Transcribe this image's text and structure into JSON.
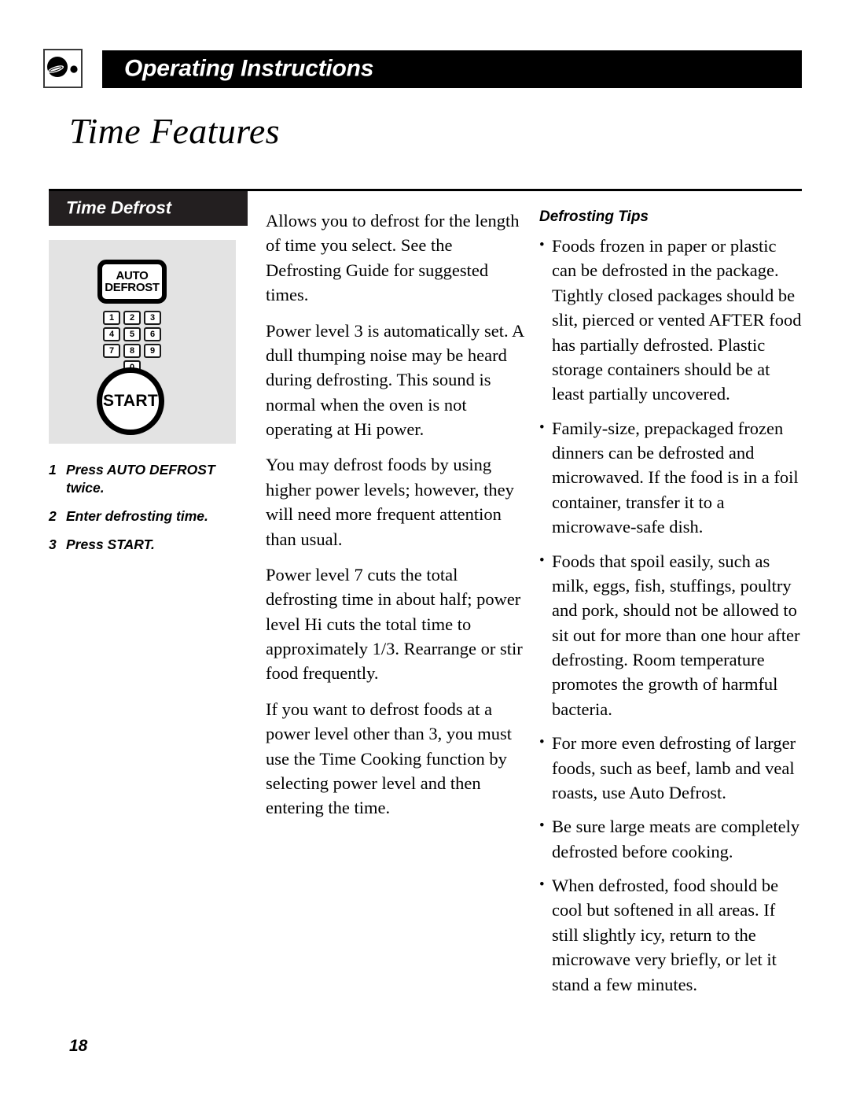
{
  "header": {
    "icon_name": "dial-knob-icon",
    "title": "Operating Instructions"
  },
  "page_title": "Time Features",
  "left_column": {
    "section_heading": "Time Defrost",
    "control_panel": {
      "auto_defrost_button": {
        "line1": "AUTO",
        "line2": "DEFROST"
      },
      "keypad": [
        [
          "1",
          "2",
          "3"
        ],
        [
          "4",
          "5",
          "6"
        ],
        [
          "7",
          "8",
          "9"
        ],
        [
          "0"
        ]
      ],
      "start_button": "START"
    },
    "steps": [
      {
        "num": "1",
        "text": "Press AUTO DEFROST twice."
      },
      {
        "num": "2",
        "text": "Enter defrosting time."
      },
      {
        "num": "3",
        "text": "Press START."
      }
    ]
  },
  "middle_column": {
    "paragraphs": [
      "Allows you to defrost for the length of time you select. See the Defrosting Guide for suggested times.",
      "Power level 3 is automatically set. A dull thumping noise may be heard during defrosting. This sound is normal when the oven is not operating at Hi power.",
      "You may defrost foods by using higher power levels; however, they will need more frequent attention than usual.",
      "Power level 7 cuts the total defrosting time in about half; power level Hi cuts the total time to approximately 1/3. Rearrange or stir food frequently.",
      "If you want to defrost foods at a power level other than 3, you must use the Time Cooking function by selecting power level and then entering the time."
    ]
  },
  "right_column": {
    "heading": "Defrosting Tips",
    "bullet_glyph": "•",
    "tips": [
      "Foods frozen in paper or plastic can be defrosted in the package. Tightly closed packages should be slit, pierced or vented AFTER food has partially defrosted. Plastic storage containers should be at least partially uncovered.",
      "Family-size, prepackaged frozen dinners can be defrosted and microwaved. If the food is in a foil container, transfer it to a microwave-safe dish.",
      "Foods that spoil easily, such as milk, eggs, fish, stuffings, poultry and pork, should not be allowed to sit out for more than one hour after defrosting. Room temperature promotes the growth of harmful bacteria.",
      "For more even defrosting of larger foods, such as beef, lamb and veal roasts, use Auto Defrost.",
      "Be sure large meats are completely defrosted before cooking.",
      "When defrosted, food should be cool but softened in all areas. If still slightly icy, return to the microwave very briefly, or let it stand a few minutes."
    ]
  },
  "footer": {
    "page_number": "18"
  },
  "colors": {
    "header_bar": "#000000",
    "section_bar": "#231f20",
    "panel_background": "#e3e3e3",
    "text": "#000000",
    "page_background": "#ffffff"
  }
}
